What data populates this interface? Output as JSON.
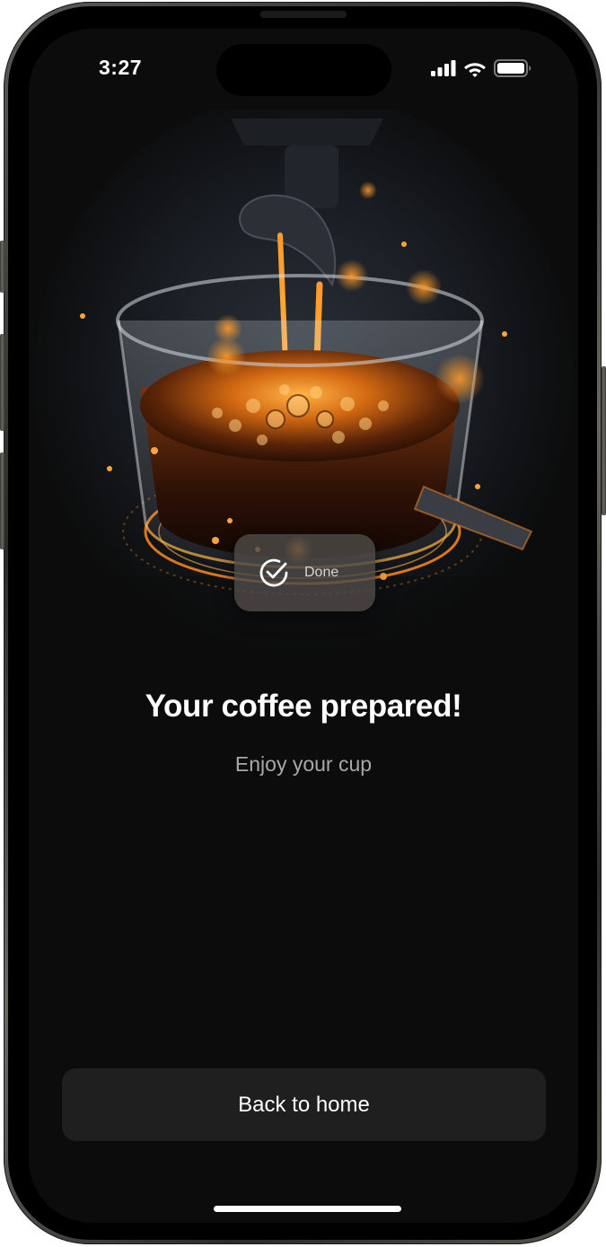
{
  "status_bar": {
    "time": "3:27",
    "icons": [
      "signal-icon",
      "wifi-icon",
      "battery-icon"
    ]
  },
  "hero": {
    "image": "espresso-pouring-into-glass-cup",
    "badge": {
      "icon": "check-circle-icon",
      "label": "Done"
    }
  },
  "main": {
    "title": "Your coffee prepared!",
    "subtitle": "Enjoy your cup"
  },
  "actions": {
    "back_label": "Back to home"
  },
  "colors": {
    "background": "#0c0c0c",
    "button_bg": "#1f1f1f",
    "accent_orange": "#ff8a1e"
  }
}
